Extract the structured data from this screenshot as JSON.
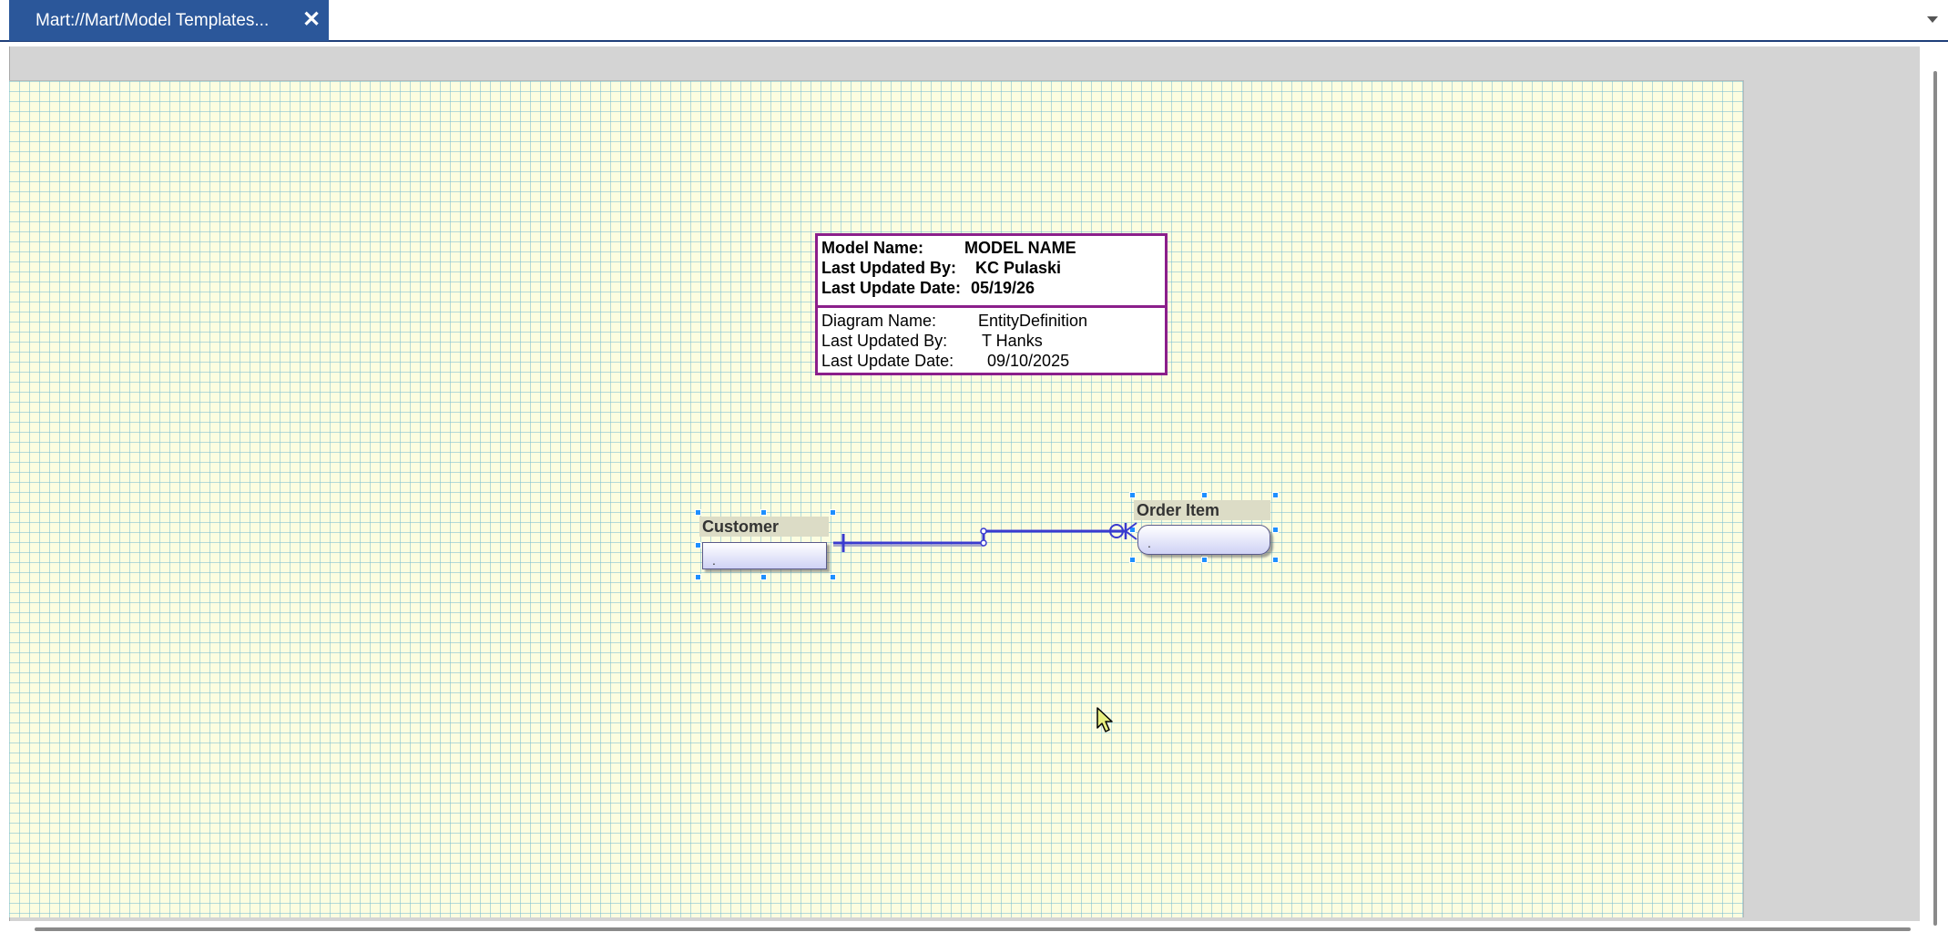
{
  "tab": {
    "title": "Mart://Mart/Model Templates...",
    "close_glyph": "✕"
  },
  "title_block": {
    "model_rows": [
      {
        "label": "Model Name:",
        "value": "MODEL NAME"
      },
      {
        "label": "Last Updated By:",
        "value": "KC Pulaski"
      },
      {
        "label": "Last Update Date:",
        "value": "05/19/26"
      }
    ],
    "diagram_rows": [
      {
        "label": "Diagram Name:",
        "value": "EntityDefinition"
      },
      {
        "label": "Last Updated By:",
        "value": "T Hanks"
      },
      {
        "label": "Last Update Date:",
        "value": "09/10/2025"
      }
    ]
  },
  "entities": {
    "customer": {
      "name": "Customer",
      "attr": "."
    },
    "order_item": {
      "name": "Order Item",
      "attr": "."
    }
  },
  "icons": {
    "close": "close-icon",
    "dropdown": "chevron-down-icon",
    "cursor": "mouse-pointer-icon"
  },
  "colors": {
    "tab_active": "#2b579a",
    "canvas_background": "#fcfde0",
    "grid_line": "#78bed2",
    "title_block_border": "#8b1f8b",
    "relationship_line": "#3a3acf",
    "selection_handle": "#1e8fff"
  }
}
